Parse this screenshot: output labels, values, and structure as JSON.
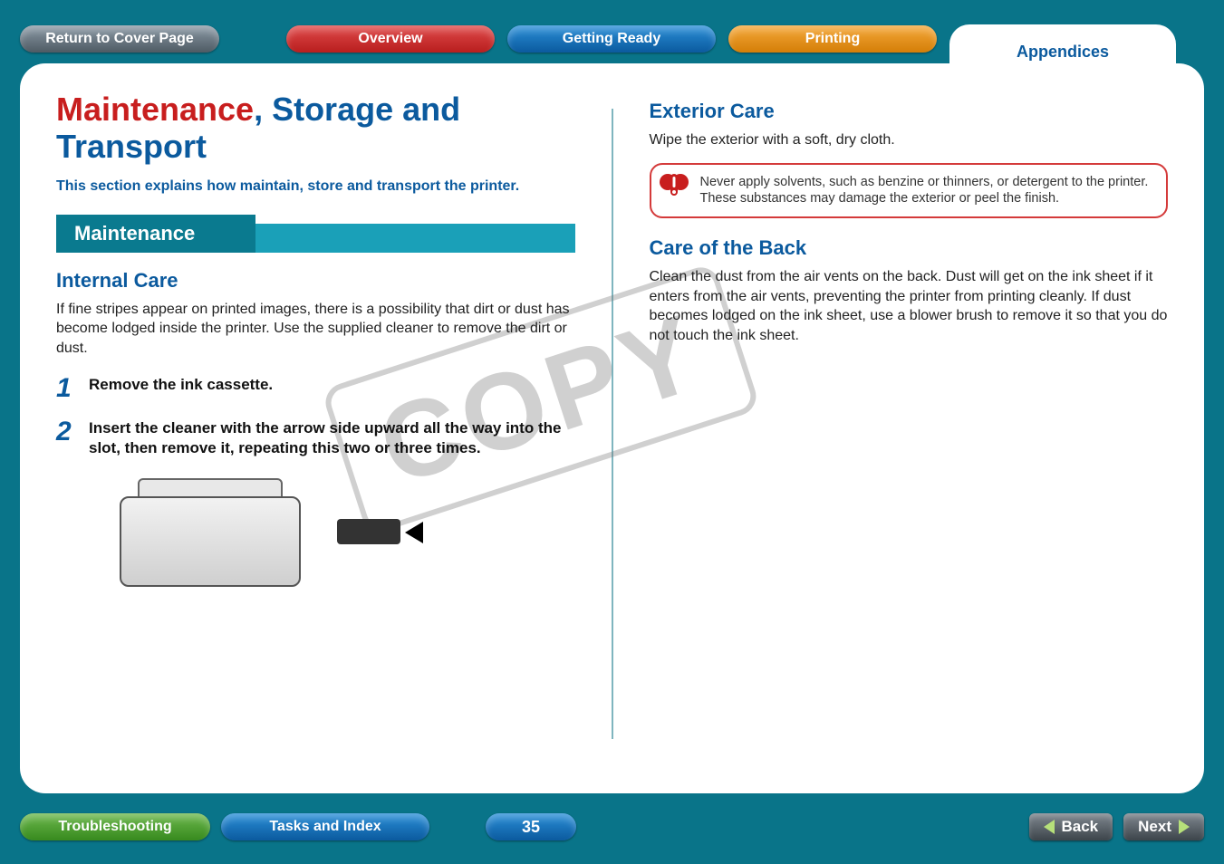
{
  "topnav": {
    "return_label": "Return to Cover Page",
    "overview_label": "Overview",
    "getting_ready_label": "Getting Ready",
    "printing_label": "Printing",
    "appendices_label": "Appendices"
  },
  "page": {
    "title_highlight": "Maintenance",
    "title_rest": ", Storage and Transport",
    "intro": "This section explains how maintain, store and transport the printer.",
    "section_label": "Maintenance",
    "left": {
      "sub1": "Internal Care",
      "body1": "If fine stripes appear on printed images, there is a possibility that dirt or dust has become lodged inside the printer. Use the supplied cleaner to remove the dirt or dust.",
      "step1_num": "1",
      "step1_text": "Remove the ink cassette.",
      "step2_num": "2",
      "step2_text": "Insert the cleaner with the arrow side upward all the way into the slot, then remove it, repeating this two or three times."
    },
    "right": {
      "sub1": "Exterior Care",
      "body1": "Wipe the exterior with a soft, dry cloth.",
      "callout": "Never apply solvents, such as benzine or thinners, or detergent to the printer. These substances may damage the exterior or peel the finish.",
      "sub2": "Care of the Back",
      "body2": "Clean the dust from the air vents on the back. Dust will get on the ink sheet if it enters from the air vents, preventing the printer from printing cleanly. If dust becomes lodged on the ink sheet, use a blower brush to remove it so that you do not touch the ink sheet."
    },
    "watermark": "COPY"
  },
  "bottom": {
    "troubleshooting_label": "Troubleshooting",
    "tasks_label": "Tasks and Index",
    "page_number": "35",
    "back_label": "Back",
    "next_label": "Next"
  }
}
